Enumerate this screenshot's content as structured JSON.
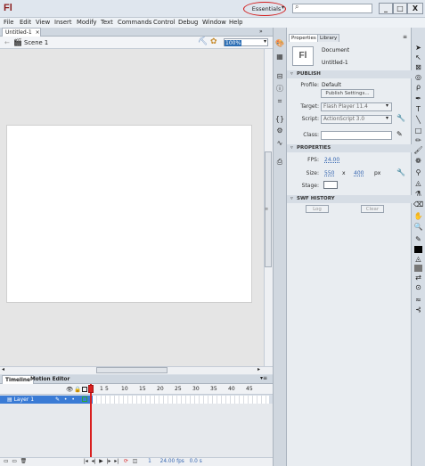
{
  "app": {
    "logo": "Fl"
  },
  "workspace": {
    "label": "Essentials",
    "highlight_color": "#d21c1c"
  },
  "search": {
    "placeholder": ""
  },
  "window_controls": {
    "minimize": "_",
    "maximize": "□",
    "close": "X"
  },
  "menu": [
    "File",
    "Edit",
    "View",
    "Insert",
    "Modify",
    "Text",
    "Commands",
    "Control",
    "Debug",
    "Window",
    "Help"
  ],
  "document": {
    "tab": "Untitled-1",
    "tab_close": "×",
    "scene": "Scene 1",
    "zoom": "100%"
  },
  "timeline": {
    "tabs": [
      "Timeline",
      "Motion Editor"
    ],
    "frame_numbers": [
      "1",
      "5",
      "10",
      "15",
      "20",
      "25",
      "30",
      "35",
      "40",
      "45"
    ],
    "layer_name": "Layer 1",
    "fps_readout": "24.00 fps",
    "time_readout": "0.0 s",
    "frame_readout": "1"
  },
  "properties": {
    "tabs": [
      "Properties",
      "Library"
    ],
    "doc_icon": "Fl",
    "doc_type": "Document",
    "doc_name": "Untitled-1",
    "publish": {
      "header": "PUBLISH",
      "profile_label": "Profile:",
      "profile_value": "Default",
      "settings_button": "Publish Settings...",
      "target_label": "Target:",
      "target_value": "Flash Player 11.4",
      "script_label": "Script:",
      "script_value": "ActionScript 3.0",
      "class_label": "Class:"
    },
    "props": {
      "header": "PROPERTIES",
      "fps_label": "FPS:",
      "fps_value": "24.00",
      "size_label": "Size:",
      "width": "550",
      "x": "x",
      "height": "400",
      "unit": "px",
      "stage_label": "Stage:"
    },
    "swf": {
      "header": "SWF HISTORY",
      "log": "Log",
      "clear": "Clear"
    }
  }
}
